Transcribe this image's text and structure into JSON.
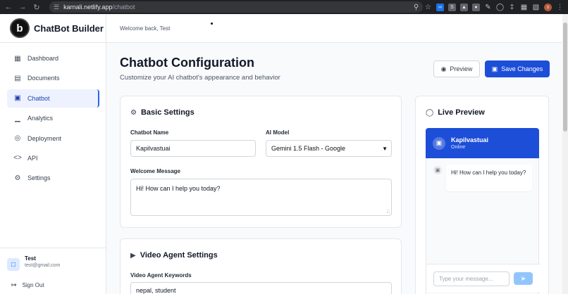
{
  "browser": {
    "url_host": "karnali.netlify.app",
    "url_path": "/chatbot",
    "profile_initial": "s"
  },
  "sidebar": {
    "brand": "ChatBot Builder",
    "logo_letter": "b",
    "items": [
      {
        "label": "Dashboard",
        "icon": "dashboard-icon"
      },
      {
        "label": "Documents",
        "icon": "document-icon"
      },
      {
        "label": "Chatbot",
        "icon": "bot-icon",
        "active": true
      },
      {
        "label": "Analytics",
        "icon": "bar-chart-icon"
      },
      {
        "label": "Deployment",
        "icon": "globe-icon"
      },
      {
        "label": "API",
        "icon": "code-icon"
      },
      {
        "label": "Settings",
        "icon": "gear-icon"
      }
    ],
    "user": {
      "name": "Test",
      "email": "test@gmail.com"
    },
    "signout": "Sign Out"
  },
  "topbar": {
    "welcome": "Welcome back, Test"
  },
  "header": {
    "title": "Chatbot Configuration",
    "subtitle": "Customize your AI chatbot's appearance and behavior",
    "preview_label": "Preview",
    "save_label": "Save Changes"
  },
  "basic": {
    "title": "Basic Settings",
    "name_label": "Chatbot Name",
    "name_value": "Kapilvastuai",
    "model_label": "AI Model",
    "model_value": "Gemini 1.5 Flash - Google",
    "welcome_label": "Welcome Message",
    "welcome_value": "Hi! How can I help you today?"
  },
  "video": {
    "title": "Video Agent Settings",
    "keywords_label": "Video Agent Keywords",
    "keywords_value": "nepal, student"
  },
  "preview": {
    "title": "Live Preview",
    "bot_name": "Kapilvastuai",
    "status": "Online",
    "message": "Hi! How can I help you today?",
    "input_placeholder": "Type your message..."
  },
  "colors": {
    "accent": "#1d4ed8",
    "active_nav_bg": "#eef2ff",
    "send_button": "#93c5fd"
  }
}
